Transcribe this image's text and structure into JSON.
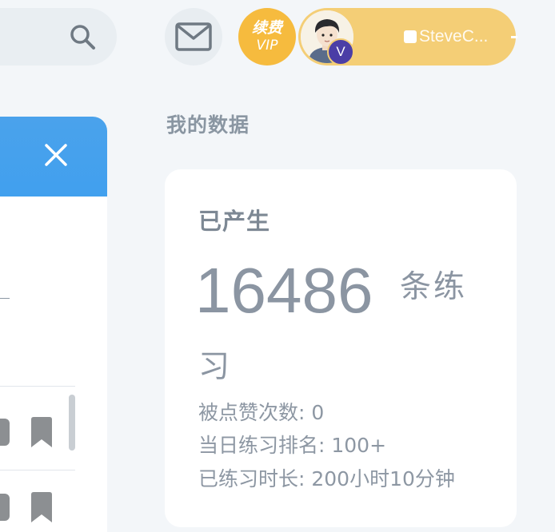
{
  "topbar": {
    "search_icon": "search-icon",
    "mail_icon": "mail-icon",
    "vip_top": "续费",
    "vip_bottom": "VIP",
    "user_name": "SteveC...",
    "user_badge": "V"
  },
  "panel": {
    "close_icon": "close-icon",
    "row_icon": "bookmark-icon"
  },
  "data_section": {
    "title": "我的数据",
    "card": {
      "label": "已产生",
      "number": "16486",
      "unit_part1": "条练",
      "unit_part2": "习",
      "likes": "被点赞次数: 0",
      "rank": "当日练习排名: 100+",
      "duration": "已练习时长: 200小时10分钟"
    }
  },
  "colors": {
    "accent_blue": "#41a0ee",
    "vip_gold": "#f6bb3e",
    "user_pill": "#f4ce76",
    "text_gray": "#8b95a2"
  }
}
